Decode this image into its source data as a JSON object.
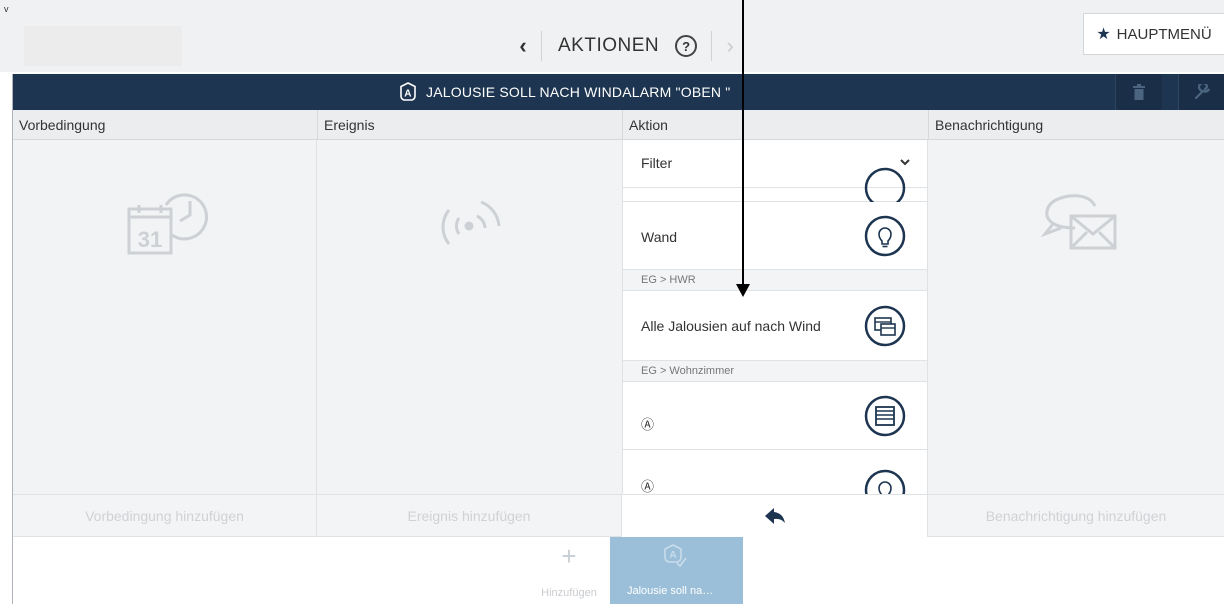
{
  "top": {
    "corner_mark": "v",
    "back_symbol": "‹",
    "title": "AKTIONEN",
    "help_symbol": "?",
    "forward_symbol": "›",
    "main_menu_label": "HAUPTMENÜ",
    "main_menu_icon": "star-icon"
  },
  "titlebar": {
    "title": "JALOUSIE SOLL NACH WINDALARM \"OBEN \"",
    "icon": "automation-icon",
    "buttons": [
      "trash-icon",
      "wrench-icon"
    ],
    "bg_color": "#1d3550"
  },
  "columns": [
    {
      "header": "Vorbedingung",
      "icon": "calendar-clock-icon",
      "add_label": "Vorbedingung hinzufügen"
    },
    {
      "header": "Ereignis",
      "icon": "signal-icon",
      "add_label": "Ereignis hinzufügen"
    },
    {
      "header": "Aktion",
      "icon": "",
      "add_label": ""
    },
    {
      "header": "Benachrichtigung",
      "icon": "message-mail-icon",
      "add_label": "Benachrichtigung hinzufügen"
    }
  ],
  "action_list": {
    "filter_label": "Filter",
    "items": [
      {
        "label": "Wand",
        "icon": "bulb-icon"
      },
      {
        "label": "Alle Jalousien auf nach Wind",
        "icon": "blind-group-icon"
      },
      {
        "label": "Ⓐ",
        "icon": "blind-icon"
      },
      {
        "label": "Ⓐ",
        "icon": "bulb-icon"
      }
    ],
    "rooms": [
      "EG > HWR",
      "EG > Wohnzimmer"
    ],
    "back_icon": "reply-arrow-icon"
  },
  "bottom": {
    "add_symbol": "+",
    "add_label": "Hinzufügen",
    "active_label": "Jalousie soll na…",
    "active_color": "#9bbfd8"
  }
}
